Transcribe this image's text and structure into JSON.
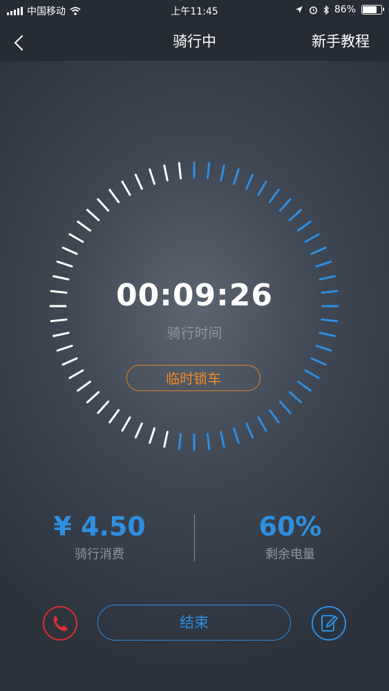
{
  "status_bar": {
    "carrier": "中国移动",
    "time": "上午11:45",
    "battery_percent": "86%",
    "battery_level": 0.86
  },
  "nav": {
    "title": "骑行中",
    "tutorial": "新手教程"
  },
  "timer": {
    "elapsed": "00:09:26",
    "label": "骑行时间",
    "progress": 0.53
  },
  "lock_button": "临时锁车",
  "cost": {
    "value": "¥ 4.50",
    "label": "骑行消费"
  },
  "battery": {
    "value": "60%",
    "label": "剩余电量"
  },
  "end_button": "结束",
  "colors": {
    "accent": "#2e8fe0",
    "lock": "#f08a28",
    "danger": "#e02e2e"
  },
  "icons": {
    "phone": "phone-icon",
    "edit": "edit-icon",
    "back": "back-chevron-icon"
  }
}
